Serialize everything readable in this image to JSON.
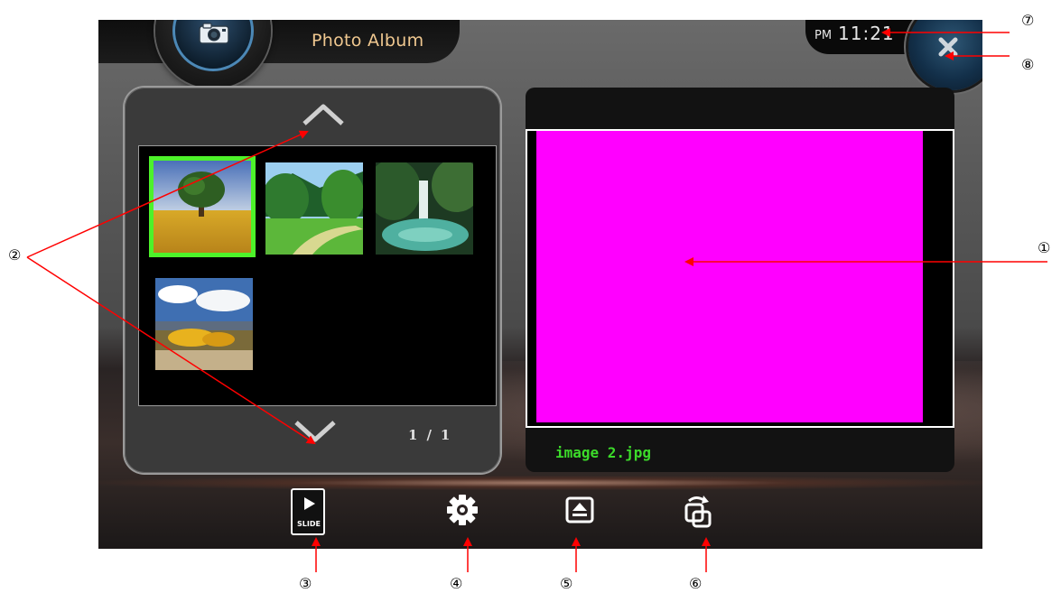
{
  "app": {
    "title": "Photo Album"
  },
  "clock": {
    "ampm": "PM",
    "time": "11:21"
  },
  "thumbnails": [
    {
      "name": "thumbnail-tree-field",
      "selected": true
    },
    {
      "name": "thumbnail-garden-lawn",
      "selected": false
    },
    {
      "name": "thumbnail-waterfall",
      "selected": false
    },
    {
      "name": "thumbnail-yellow-trees-sky",
      "selected": false
    }
  ],
  "pagination": {
    "current": "1",
    "separator": "/",
    "total": "1"
  },
  "preview": {
    "file_name": "image 2.jpg",
    "image_color": "#ff00ff"
  },
  "toolbar": {
    "slide_label": "SLIDE"
  },
  "callouts": [
    "①",
    "②",
    "③",
    "④",
    "⑤",
    "⑥",
    "⑦",
    "⑧"
  ],
  "colors": {
    "selection": "#4df22a",
    "filename": "#3cdb2a",
    "title": "#f0c890",
    "callout_arrow": "#ff0000"
  },
  "icons": [
    "camera-icon",
    "close-icon",
    "chevron-up-icon",
    "chevron-down-icon",
    "play-icon",
    "gear-icon",
    "eject-icon",
    "rotate-icon"
  ]
}
